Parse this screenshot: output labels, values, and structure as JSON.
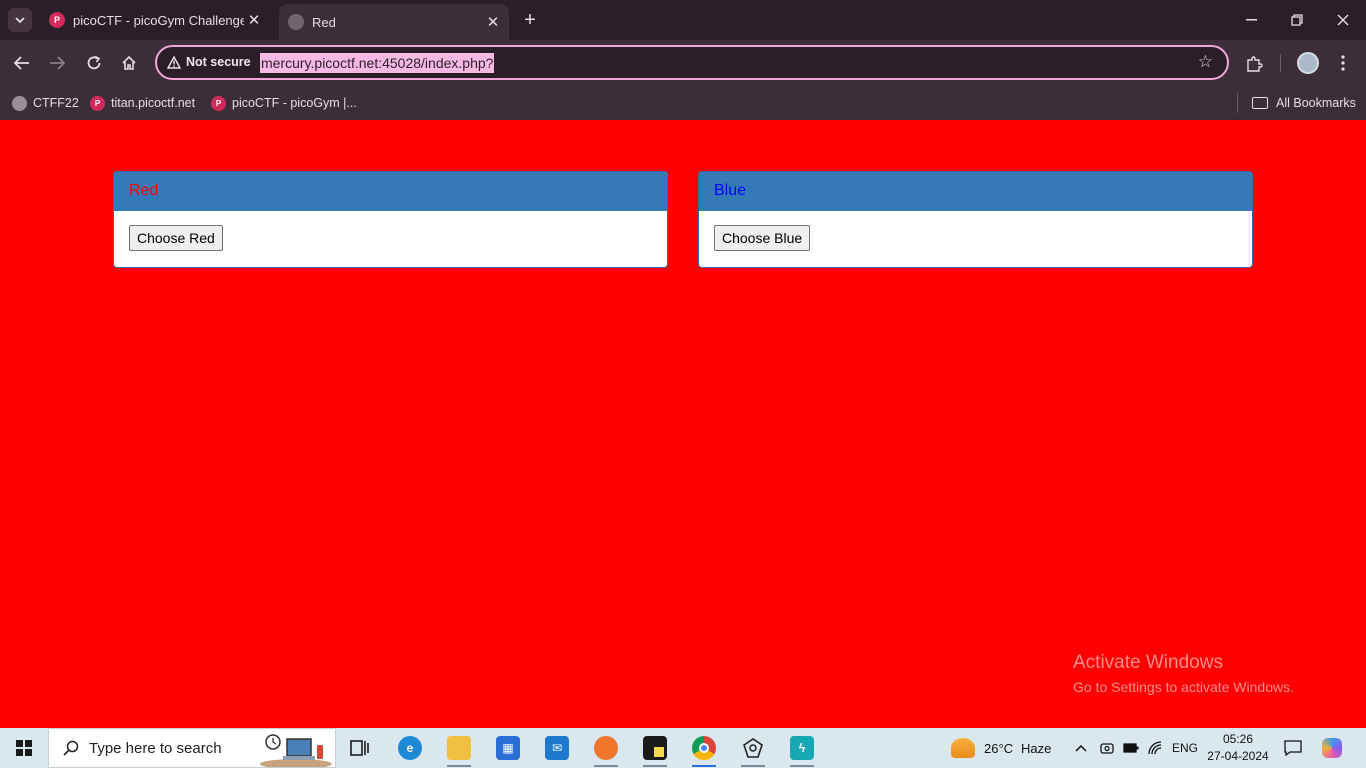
{
  "browser": {
    "tabs": [
      {
        "title": "picoCTF - picoGym Challenges",
        "favicon": "picoctf-icon",
        "active": false
      },
      {
        "title": "Red",
        "favicon": "globe-icon",
        "active": true
      }
    ],
    "security_label": "Not secure",
    "url": "mercury.picoctf.net:45028/index.php?",
    "bookmarks": [
      {
        "label": "CTFF22",
        "icon": "globe-icon"
      },
      {
        "label": "titan.picoctf.net",
        "icon": "picoctf-icon"
      },
      {
        "label": "picoCTF - picoGym |..."
      }
    ],
    "all_bookmarks_label": "All Bookmarks"
  },
  "page": {
    "background": "#ff0000",
    "panels": [
      {
        "heading": "Red",
        "heading_color": "#ff0000",
        "button": "Choose Red"
      },
      {
        "heading": "Blue",
        "heading_color": "#0000ff",
        "button": "Choose Blue"
      }
    ],
    "watermark": {
      "title": "Activate Windows",
      "subtitle": "Go to Settings to activate Windows."
    }
  },
  "taskbar": {
    "search_placeholder": "Type here to search",
    "weather": {
      "temp": "26°C",
      "condition": "Haze"
    },
    "language": "ENG",
    "time": "05:26",
    "date": "27-04-2024"
  }
}
